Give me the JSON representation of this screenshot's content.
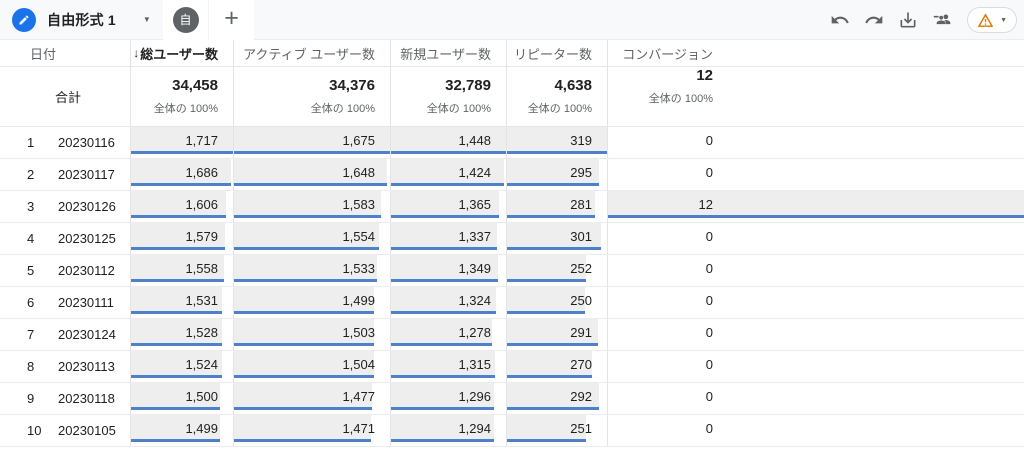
{
  "toolbar": {
    "title": "自由形式 1",
    "tab_label": "自",
    "add_tab_label": "+",
    "title_caret": "▼",
    "pill_caret": "▼"
  },
  "table": {
    "sort_indicator": "↓",
    "columns": [
      {
        "key": "date",
        "label": "日付"
      },
      {
        "key": "totalUsers",
        "label": "総ユーザー数",
        "sorted": true
      },
      {
        "key": "activeUsers",
        "label": "アクティブ ユーザー数"
      },
      {
        "key": "newUsers",
        "label": "新規ユーザー数"
      },
      {
        "key": "returningUsers",
        "label": "リピーター数"
      },
      {
        "key": "conversions",
        "label": "コンバージョン"
      }
    ],
    "totals": {
      "label": "合計",
      "values": [
        "34,458",
        "34,376",
        "32,789",
        "4,638",
        "12"
      ],
      "subtexts": [
        "全体の 100%",
        "全体の 100%",
        "全体の 100%",
        "全体の 100%",
        "全体の 100%"
      ]
    },
    "rows": [
      {
        "rank": "1",
        "date": "20230116",
        "values": [
          "1,717",
          "1,675",
          "1,448",
          "319",
          "0"
        ]
      },
      {
        "rank": "2",
        "date": "20230117",
        "values": [
          "1,686",
          "1,648",
          "1,424",
          "295",
          "0"
        ]
      },
      {
        "rank": "3",
        "date": "20230126",
        "values": [
          "1,606",
          "1,583",
          "1,365",
          "281",
          "12"
        ]
      },
      {
        "rank": "4",
        "date": "20230125",
        "values": [
          "1,579",
          "1,554",
          "1,337",
          "301",
          "0"
        ]
      },
      {
        "rank": "5",
        "date": "20230112",
        "values": [
          "1,558",
          "1,533",
          "1,349",
          "252",
          "0"
        ]
      },
      {
        "rank": "6",
        "date": "20230111",
        "values": [
          "1,531",
          "1,499",
          "1,324",
          "250",
          "0"
        ]
      },
      {
        "rank": "7",
        "date": "20230124",
        "values": [
          "1,528",
          "1,503",
          "1,278",
          "291",
          "0"
        ]
      },
      {
        "rank": "8",
        "date": "20230113",
        "values": [
          "1,524",
          "1,504",
          "1,315",
          "270",
          "0"
        ]
      },
      {
        "rank": "9",
        "date": "20230118",
        "values": [
          "1,500",
          "1,477",
          "1,296",
          "292",
          "0"
        ]
      },
      {
        "rank": "10",
        "date": "20230105",
        "values": [
          "1,499",
          "1,471",
          "1,294",
          "251",
          "0"
        ]
      }
    ]
  },
  "colors": {
    "edit_badge_blue": "#1a73e8",
    "bar_underline_blue": "#4d82c9",
    "bar_fill_gray": "#eeeeef",
    "warning_orange": "#e37400",
    "tab_circle_gray": "#5f6368"
  }
}
